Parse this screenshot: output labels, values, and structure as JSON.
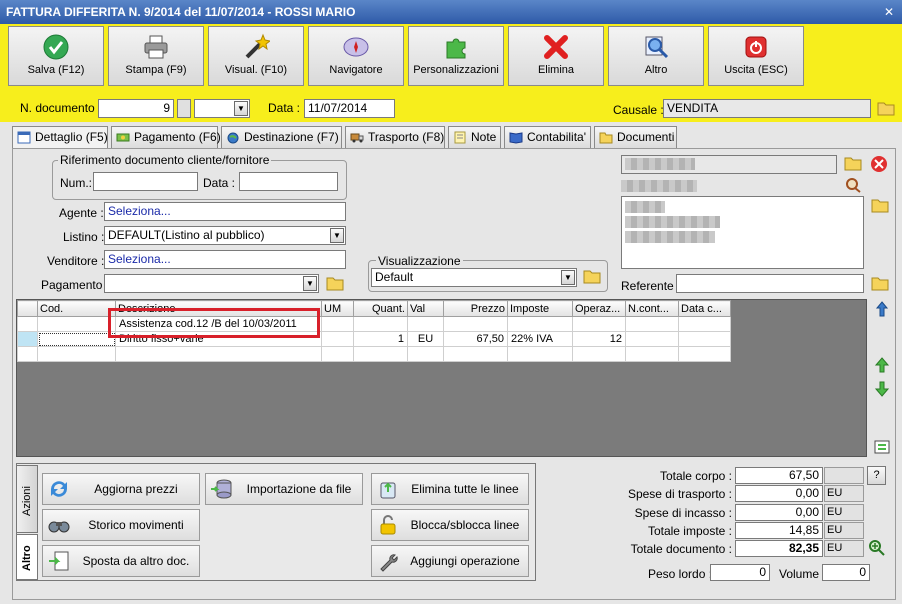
{
  "window": {
    "title": "FATTURA DIFFERITA N. 9/2014 del 11/07/2014 - ROSSI MARIO",
    "close_glyph": "✕"
  },
  "toolbar": [
    {
      "label": "Salva (F12)",
      "icon": "check-icon"
    },
    {
      "label": "Stampa (F9)",
      "icon": "printer-icon"
    },
    {
      "label": "Visual. (F10)",
      "icon": "magic-wand-icon"
    },
    {
      "label": "Navigatore",
      "icon": "compass-icon"
    },
    {
      "label": "Personalizzazioni",
      "icon": "puzzle-icon"
    },
    {
      "label": "Elimina",
      "icon": "delete-x-icon"
    },
    {
      "label": "Altro",
      "icon": "magnifier-icon"
    },
    {
      "label": "Uscita (ESC)",
      "icon": "power-icon"
    }
  ],
  "header": {
    "doc_number_label": "N. documento :",
    "doc_number": "9",
    "date_label": "Data :",
    "date": "11/07/2014",
    "causale_label": "Causale :",
    "causale": "VENDITA"
  },
  "tabs": [
    {
      "label": "Dettaglio (F5)",
      "icon": "calendar-icon"
    },
    {
      "label": "Pagamento (F6)",
      "icon": "money-icon"
    },
    {
      "label": "Destinazione (F7)",
      "icon": "globe-icon"
    },
    {
      "label": "Trasporto (F8)",
      "icon": "truck-icon"
    },
    {
      "label": "Note",
      "icon": "note-icon"
    },
    {
      "label": "Contabilita'",
      "icon": "book-icon"
    },
    {
      "label": "Documenti",
      "icon": "folder-icon"
    }
  ],
  "riferimento": {
    "title": "Riferimento documento cliente/fornitore",
    "num_label": "Num.:",
    "num": "",
    "data_label": "Data :",
    "data": ""
  },
  "form": {
    "agente_label": "Agente :",
    "agente": "Seleziona...",
    "listino_label": "Listino :",
    "listino": "DEFAULT(Listino al pubblico)",
    "venditore_label": "Venditore :",
    "venditore": "Seleziona...",
    "pagamento_label": "Pagamento :",
    "pagamento": ""
  },
  "visualizzazione": {
    "title": "Visualizzazione",
    "value": "Default"
  },
  "referente": {
    "label": "Referente",
    "value": ""
  },
  "grid": {
    "columns": [
      "",
      "Cod.",
      "Descrizione",
      "UM",
      "Quant.",
      "Val",
      "Prezzo",
      "Imposte",
      "Operaz...",
      "N.cont...",
      "Data c..."
    ],
    "rows": [
      [
        "",
        "",
        "Assistenza cod.12 /B del 10/03/2011",
        "",
        "",
        "",
        "",
        "",
        "",
        "",
        ""
      ],
      [
        "",
        "",
        "Diritto fisso+varie",
        "",
        "1",
        "EU",
        "67,50",
        "22% IVA",
        "12",
        "",
        ""
      ],
      [
        "",
        "",
        "",
        "",
        "",
        "",
        "",
        "",
        "",
        "",
        ""
      ]
    ]
  },
  "actions": {
    "vtab_azioni": "Azioni",
    "vtab_altro": "Altro",
    "buttons": [
      {
        "label": "Aggiorna prezzi",
        "icon": "refresh-icon"
      },
      {
        "label": "Importazione da file",
        "icon": "database-icon"
      },
      {
        "label": "Elimina tutte le linee",
        "icon": "recycle-icon"
      },
      {
        "label": "Storico movimenti",
        "icon": "binoculars-icon"
      },
      {
        "label": "Blocca/sblocca linee",
        "icon": "padlock-icon"
      },
      {
        "label": "Sposta da altro doc.",
        "icon": "move-document-icon"
      },
      {
        "label": "Aggiungi operazione",
        "icon": "wrench-icon"
      }
    ]
  },
  "totals": {
    "corpo_label": "Totale corpo :",
    "corpo": "67,50",
    "help": "?",
    "trasporto_label": "Spese di trasporto :",
    "trasporto": "0,00",
    "trasporto_cur": "EU",
    "incasso_label": "Spese di incasso :",
    "incasso": "0,00",
    "incasso_cur": "EU",
    "imposte_label": "Totale imposte :",
    "imposte": "14,85",
    "imposte_cur": "EU",
    "documento_label": "Totale documento :",
    "documento": "82,35",
    "documento_cur": "EU",
    "peso_label": "Peso lordo :",
    "peso": "0",
    "volume_label": "Volume :",
    "volume": "0"
  },
  "colors": {
    "toolbar_bg": "#f7ee1c",
    "title_bg": "#2e5aa8",
    "highlight_border": "#d8202a"
  }
}
